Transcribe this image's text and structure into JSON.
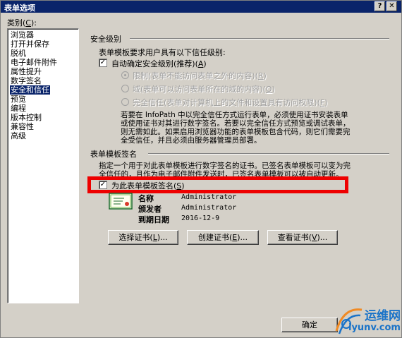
{
  "window": {
    "title": "表单选项",
    "help": "?",
    "close": "✕"
  },
  "category": {
    "label": "类别(",
    "label_key": "C",
    "label_end": "):",
    "items": [
      "浏览器",
      "打开并保存",
      "脱机",
      "电子邮件附件",
      "属性提升",
      "数字签名",
      "安全和信任",
      "预览",
      "编程",
      "版本控制",
      "兼容性",
      "高级"
    ],
    "selected": "安全和信任"
  },
  "security": {
    "heading": "安全级别",
    "desc": "表单模板要求用户具有以下信任级别:",
    "auto_label": "自动确定安全级别(推荐)(",
    "auto_key": "A",
    "auto_end": ")",
    "auto_checked": "✓",
    "restricted": "限制(表单不能访问表单之外的内容)(",
    "restricted_key": "R",
    "restricted_end": ")",
    "domain": "域(表单可以访问表单所在的域的内容)(",
    "domain_key": "O",
    "domain_end": ")",
    "full": "完全信任(表单对计算机上的文件和设置具有访问权限)(",
    "full_key": "F",
    "full_end": ")",
    "note_lines": [
      "若要在 InfoPath 中以完全信任方式运行表单，必须使用证书安装表单",
      "或使用证书对其进行数字签名。若要以完全信任方式预览或调试表单，",
      "则无需如此。如果启用浏览器功能的表单模板包含代码，则它们需要完",
      "全受信任，并且必须由服务器管理员部署。"
    ]
  },
  "signature": {
    "heading": "表单模板签名",
    "desc_lines": [
      "指定一个用于对此表单模板进行数字签名的证书。已签名表单模板可以变为完",
      "全信任的，且作为电子邮件附件发送时，已签名表单模板可以被自动更新。"
    ],
    "sign_label": "为此表单模板签名(",
    "sign_key": "S",
    "sign_end": ")",
    "sign_checked": "✓",
    "name_label": "名称",
    "name_value": "Administrator",
    "issuer_label": "颁发者",
    "issuer_value": "Administrator",
    "expiry_label": "到期日期",
    "expiry_value": "2016-12-9"
  },
  "buttons": {
    "select_cert": "选择证书(",
    "select_key": "L",
    "select_end": ")...",
    "create_cert": "创建证书(",
    "create_key": "E",
    "create_end": ")...",
    "view_cert": "查看证书(",
    "view_key": "V",
    "view_end": ")...",
    "ok": "确定"
  },
  "watermark": {
    "line1": "运维网",
    "line2": "iyunv.com"
  },
  "colors": {
    "titlebar": "#0a246a",
    "highlight": "#ee0000",
    "face": "#d4d0c8"
  }
}
